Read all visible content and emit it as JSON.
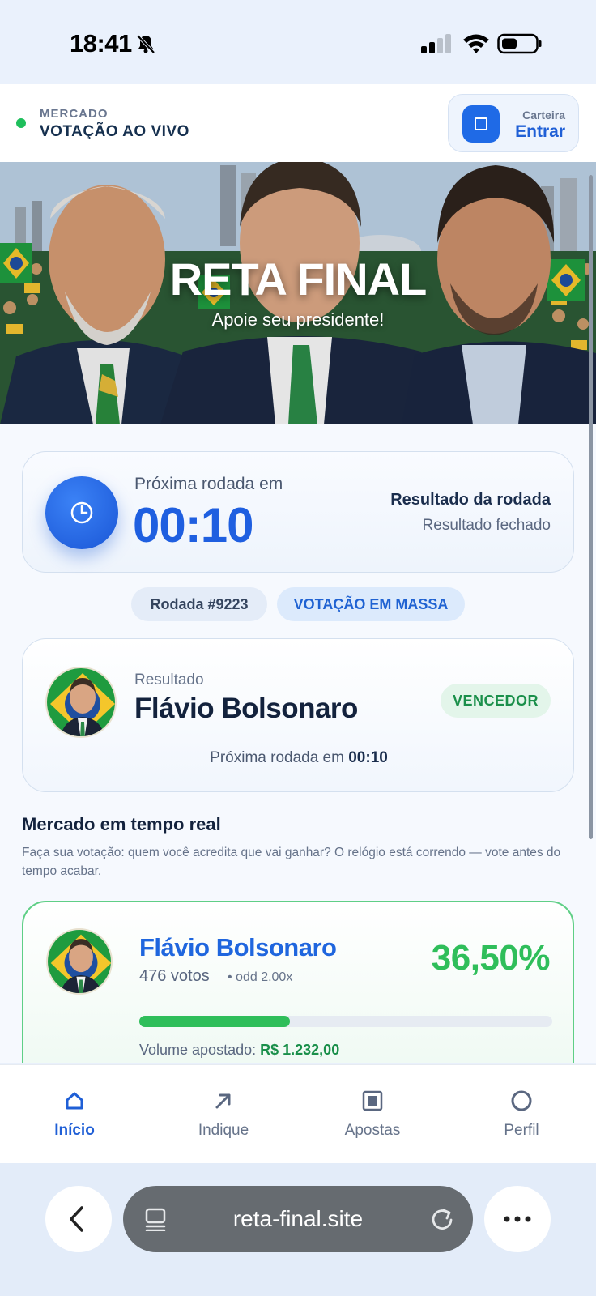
{
  "status_bar": {
    "time": "18:41"
  },
  "header": {
    "market_label": "MERCADO",
    "market_title": "VOTAÇÃO AO VIVO",
    "wallet_sub": "Carteira",
    "wallet_label": "Entrar"
  },
  "hero": {
    "title": "RETA FINAL",
    "subtitle": "Apoie seu presidente!"
  },
  "countdown": {
    "label": "Próxima rodada em",
    "time": "00:10",
    "result_title": "Resultado da rodada",
    "result_status": "Resultado fechado"
  },
  "chips": {
    "round": "Rodada #9223",
    "mass": "VOTAÇÃO EM MASSA"
  },
  "result": {
    "label": "Resultado",
    "name": "Flávio Bolsonaro",
    "badge": "VENCEDOR",
    "next_label": "Próxima rodada em",
    "next_time": "00:10"
  },
  "market": {
    "title": "Mercado em tempo real",
    "description": "Faça sua votação: quem você acredita que vai ganhar? O relógio está correndo — vote antes do tempo acabar."
  },
  "candidates": [
    {
      "name": "Flávio Bolsonaro",
      "votes": "476 votos",
      "odd": "• odd 2.00x",
      "percent_text": "36,50%",
      "percent": 36.5,
      "volume_label": "Volume apostado:",
      "volume": "R$ 1.232,00"
    }
  ],
  "tabs": [
    {
      "label": "Início",
      "icon": "home-icon",
      "active": true
    },
    {
      "label": "Indique",
      "icon": "arrow-up-right-icon",
      "active": false
    },
    {
      "label": "Apostas",
      "icon": "square-icon",
      "active": false
    },
    {
      "label": "Perfil",
      "icon": "circle-icon",
      "active": false
    }
  ],
  "browser": {
    "url": "reta-final.site"
  },
  "colors": {
    "accent": "#1f5fd6",
    "success": "#2fbe5a",
    "live": "#1fbf5c"
  }
}
